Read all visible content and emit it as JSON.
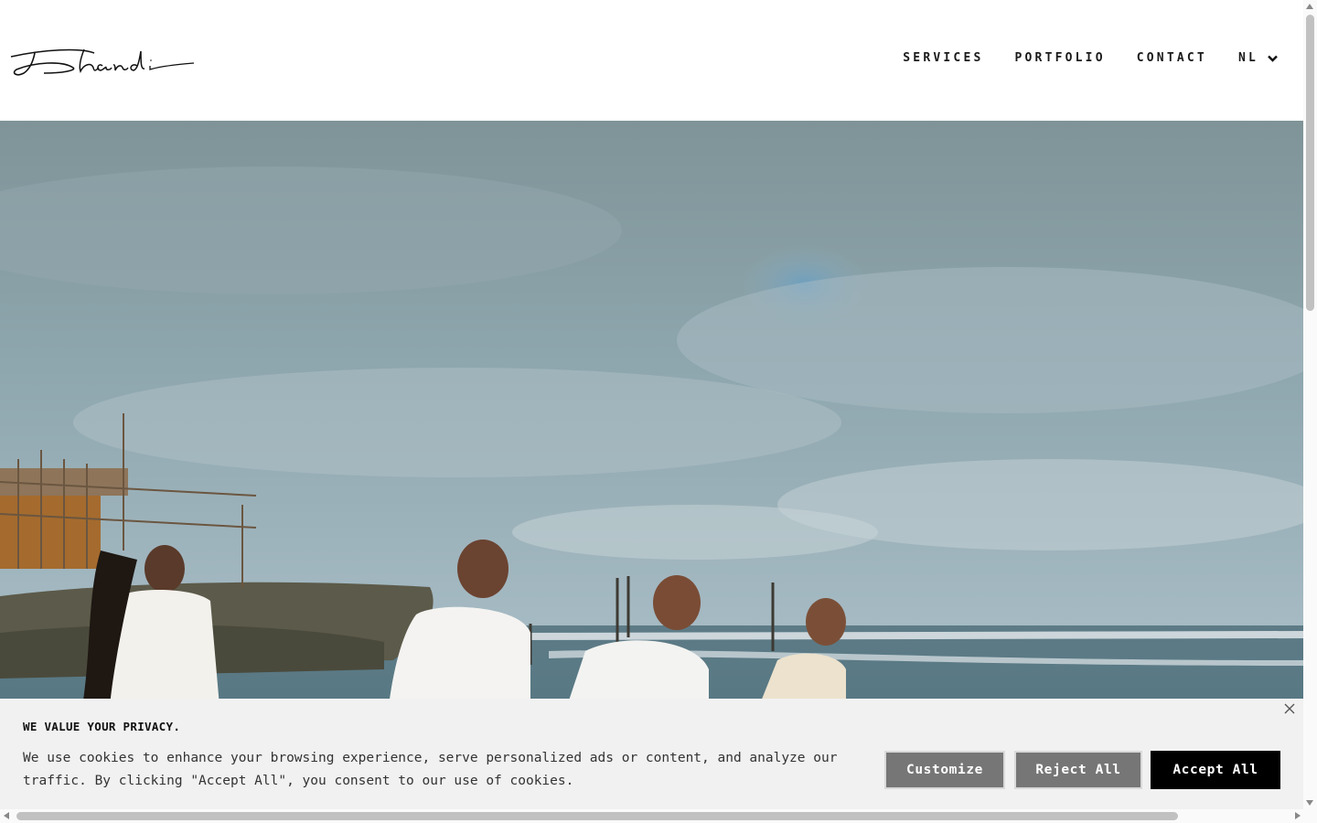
{
  "header": {
    "logo_text": "Dhandi",
    "nav": {
      "services": "SERVICES",
      "portfolio": "PORTFOLIO",
      "contact": "CONTACT",
      "language": "NL"
    }
  },
  "hero": {
    "image_icon": "beach-photo"
  },
  "cookie_banner": {
    "title": "WE VALUE YOUR PRIVACY.",
    "line1": "We use cookies to enhance your browsing experience, serve personalized ads or content, and analyze our",
    "line2": "traffic. By clicking \"Accept All\", you consent to our use of cookies.",
    "customize_label": "Customize",
    "reject_label": "Reject All",
    "accept_label": "Accept All",
    "close_icon": "close-icon"
  },
  "colors": {
    "accept_bg": "#000000",
    "secondary_bg": "#767676",
    "banner_bg": "#f1f1f1"
  }
}
